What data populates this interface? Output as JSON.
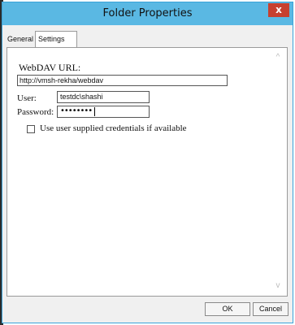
{
  "window": {
    "title": "Folder Properties",
    "close_glyph": "x"
  },
  "tabs": [
    {
      "label": "General",
      "active": false
    },
    {
      "label": "Settings",
      "active": true
    }
  ],
  "form": {
    "webdav_label": "WebDAV URL:",
    "webdav_value": "http://vmsh-rekha/webdav",
    "user_label": "User:",
    "user_value": "testdc\\shashi",
    "password_label": "Password:",
    "password_mask": "••••••••",
    "checkbox_label": "Use user supplied credentials if available",
    "checkbox_checked": false
  },
  "scrollbar": {
    "up_glyph": "^",
    "down_glyph": "v"
  },
  "buttons": {
    "ok_label": "OK",
    "cancel_label": "Cancel"
  },
  "colors": {
    "titlebar": "#5ab8e3",
    "close": "#c7402f"
  }
}
